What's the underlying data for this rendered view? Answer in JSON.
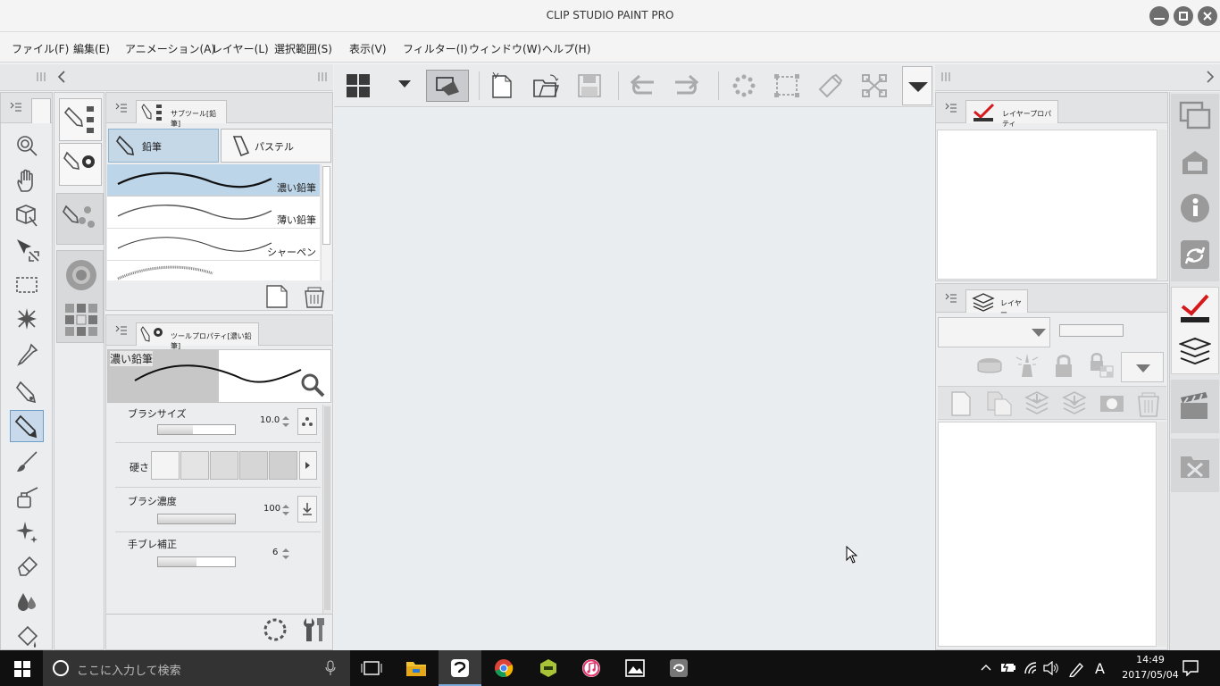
{
  "app": {
    "title": "CLIP STUDIO PAINT PRO"
  },
  "menu": [
    "ファイル(F)",
    "編集(E)",
    "アニメーション(A)",
    "レイヤー(L)",
    "選択範囲(S)",
    "表示(V)",
    "フィルター(I)",
    "ウィンドウ(W)",
    "ヘルプ(H)"
  ],
  "subtool_panel": {
    "tab": "サブツール[鉛筆]",
    "groups": [
      "鉛筆",
      "パステル"
    ],
    "brushes": [
      "濃い鉛筆",
      "薄い鉛筆",
      "シャーペン"
    ]
  },
  "tool_property": {
    "tab": "ツールプロパティ[濃い鉛筆]",
    "preview_name": "濃い鉛筆",
    "brush_size": {
      "label": "ブラシサイズ",
      "value": "10.0",
      "fill": 0.45
    },
    "hardness": {
      "label": "硬さ"
    },
    "brush_density": {
      "label": "ブラシ濃度",
      "value": "100",
      "fill": 1.0
    },
    "stabilization": {
      "label": "手ブレ補正",
      "value": "6",
      "fill": 0.5
    }
  },
  "layer_property": {
    "tab": "レイヤープロパティ"
  },
  "layer_panel": {
    "tab": "レイヤー"
  },
  "taskbar": {
    "search_placeholder": "ここに入力して検索",
    "time": "14:49",
    "date": "2017/05/04",
    "ime": "A"
  },
  "colors": {
    "accent": "#1f6fb0",
    "brand_check": "#d7191c",
    "taskbar": "#101010"
  }
}
